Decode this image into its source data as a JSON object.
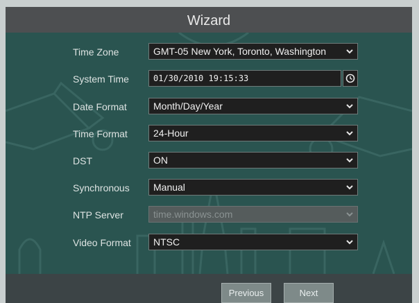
{
  "window": {
    "title": "Wizard"
  },
  "form": {
    "time_zone": {
      "label": "Time Zone",
      "value": "GMT-05 New York, Toronto, Washington"
    },
    "system_time": {
      "label": "System Time",
      "value": "01/30/2010 19:15:33"
    },
    "date_format": {
      "label": "Date Format",
      "value": "Month/Day/Year"
    },
    "time_format": {
      "label": "Time Format",
      "value": "24-Hour"
    },
    "dst": {
      "label": "DST",
      "value": "ON"
    },
    "synchronous": {
      "label": "Synchronous",
      "value": "Manual"
    },
    "ntp_server": {
      "label": "NTP Server",
      "value": "time.windows.com"
    },
    "video_format": {
      "label": "Video Format",
      "value": "NTSC"
    }
  },
  "buttons": {
    "previous": "Previous",
    "next": "Next"
  },
  "icons": {
    "clock": "clock-icon",
    "dropdown": "chevron-down-icon"
  },
  "colors": {
    "panel": "#2a5450",
    "titlebar": "#4d4f51",
    "field": "#1f1f1f",
    "button": "#7e8a89"
  }
}
